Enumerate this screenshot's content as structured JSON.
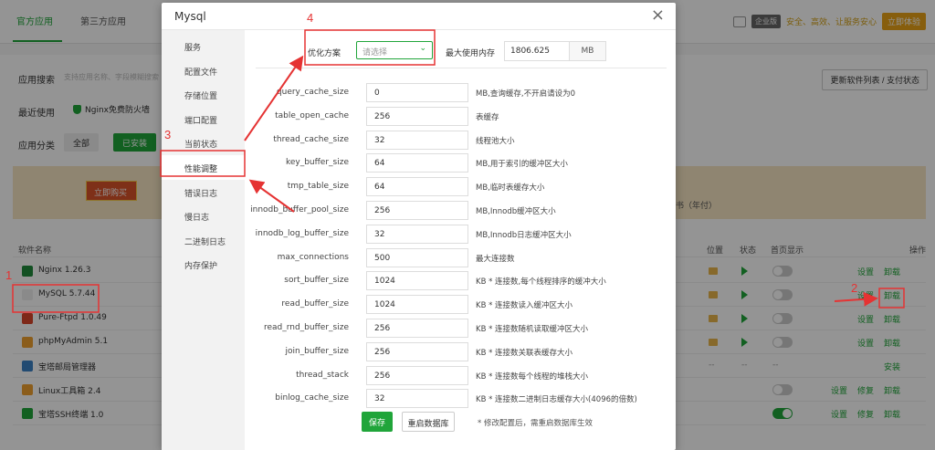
{
  "background": {
    "tabs": [
      {
        "label": "官方应用"
      },
      {
        "label": "第三方应用"
      }
    ],
    "top_right": {
      "vip_tag": "企业版",
      "safe_text": "安全、高效、让服务安心",
      "try_button": "立即体验"
    },
    "search_label": "应用搜索",
    "search_placeholder": "支持应用名称、字段模糊搜索",
    "recent_label": "最近使用",
    "recent_item": "Nginx免费防火墙",
    "category_label": "应用分类",
    "categories": [
      "全部",
      "已安装"
    ],
    "update_button": "更新软件列表 / 支付状态",
    "promo_button": "立即购买",
    "promo_text": "书（年付）",
    "table_headers": {
      "name": "软件名称",
      "location": "位置",
      "status": "状态",
      "home": "首页显示",
      "ops": "操作"
    },
    "rows": [
      {
        "name": "Nginx 1.26.3",
        "icon_color": "#1f8a3b",
        "actions": [
          "设置",
          "卸载"
        ],
        "toggle": false,
        "has_status": true
      },
      {
        "name": "MySQL 5.7.44",
        "icon_color": "#eeeeee",
        "actions": [
          "设置",
          "卸载"
        ],
        "toggle": false,
        "has_status": true
      },
      {
        "name": "Pure-Ftpd 1.0.49",
        "icon_color": "#d9452a",
        "actions": [
          "设置",
          "卸载"
        ],
        "toggle": false,
        "has_status": true
      },
      {
        "name": "phpMyAdmin 5.1",
        "icon_color": "#f0a030",
        "actions": [
          "设置",
          "卸载"
        ],
        "toggle": false,
        "has_status": true
      },
      {
        "name": "宝塔邮局管理器",
        "icon_color": "#3b82c4",
        "actions": [
          "安装"
        ],
        "dash": "--",
        "has_status": false
      },
      {
        "name": "Linux工具箱 2.4",
        "icon_color": "#f0a030",
        "actions": [
          "设置",
          "修复",
          "卸载"
        ],
        "toggle": false,
        "has_status": false
      },
      {
        "name": "宝塔SSH终端 1.0",
        "icon_color": "#20a53a",
        "actions": [
          "设置",
          "修复",
          "卸载"
        ],
        "toggle": true,
        "has_status": false
      }
    ]
  },
  "modal": {
    "title": "Mysql",
    "close_icon": "×",
    "sidebar": [
      {
        "label": "服务"
      },
      {
        "label": "配置文件"
      },
      {
        "label": "存储位置"
      },
      {
        "label": "端口配置"
      },
      {
        "label": "当前状态"
      },
      {
        "label": "性能调整"
      },
      {
        "label": "错误日志"
      },
      {
        "label": "慢日志"
      },
      {
        "label": "二进制日志"
      },
      {
        "label": "内存保护"
      }
    ],
    "active_sidebar_index": 5,
    "optimize_label": "优化方案",
    "optimize_placeholder": "请选择",
    "max_mem_label": "最大使用内存",
    "max_mem_value": "1806.625",
    "max_mem_unit": "MB",
    "params": [
      {
        "label": "query_cache_size",
        "value": "0",
        "desc": "MB,查询缓存,不开启请设为0"
      },
      {
        "label": "table_open_cache",
        "value": "256",
        "desc": "表缓存"
      },
      {
        "label": "thread_cache_size",
        "value": "32",
        "desc": "线程池大小"
      },
      {
        "label": "key_buffer_size",
        "value": "64",
        "desc": "MB,用于索引的缓冲区大小"
      },
      {
        "label": "tmp_table_size",
        "value": "64",
        "desc": "MB,临时表缓存大小"
      },
      {
        "label": "innodb_buffer_pool_size",
        "value": "256",
        "desc": "MB,Innodb缓冲区大小"
      },
      {
        "label": "innodb_log_buffer_size",
        "value": "32",
        "desc": "MB,Innodb日志缓冲区大小"
      },
      {
        "label": "max_connections",
        "value": "500",
        "desc": "最大连接数"
      },
      {
        "label": "sort_buffer_size",
        "value": "1024",
        "desc": "KB * 连接数,每个线程排序的缓冲大小"
      },
      {
        "label": "read_buffer_size",
        "value": "1024",
        "desc": "KB * 连接数读入缓冲区大小"
      },
      {
        "label": "read_rnd_buffer_size",
        "value": "256",
        "desc": "KB * 连接数随机读取缓冲区大小"
      },
      {
        "label": "join_buffer_size",
        "value": "256",
        "desc": "KB * 连接数关联表缓存大小"
      },
      {
        "label": "thread_stack",
        "value": "256",
        "desc": "KB * 连接数每个线程的堆栈大小"
      },
      {
        "label": "binlog_cache_size",
        "value": "32",
        "desc": "KB * 连接数二进制日志缓存大小(4096的倍数)"
      }
    ],
    "save_button": "保存",
    "restart_button": "重启数据库",
    "note": "* 修改配置后，需重启数据库生效"
  },
  "annotations": {
    "numbers": [
      "1",
      "2",
      "3",
      "4"
    ],
    "color": "#e53333"
  }
}
